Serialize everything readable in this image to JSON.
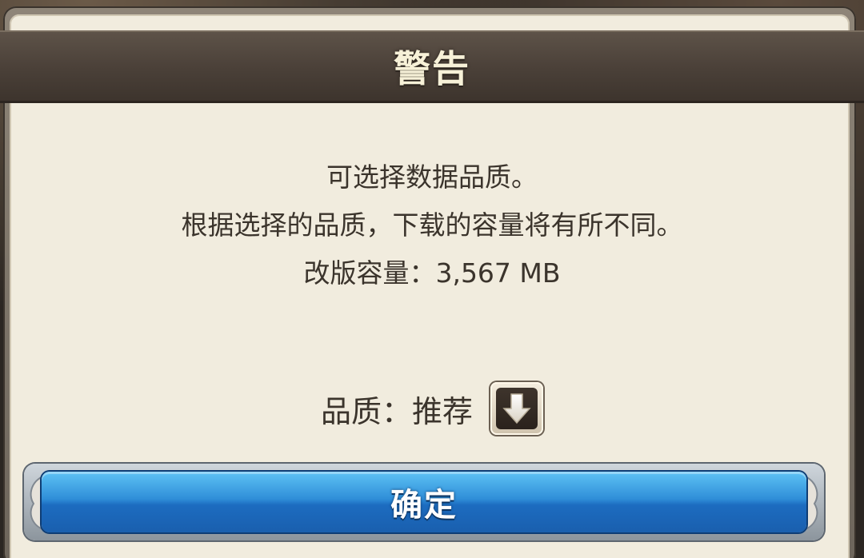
{
  "dialog": {
    "title": "警告",
    "message_lines": [
      "可选择数据品质。",
      "根据选择的品质，下载的容量将有所不同。",
      "改版容量：3,567 MB"
    ],
    "quality": {
      "label": "品质：推荐",
      "dropdown_icon": "down-arrow-icon"
    },
    "confirm_label": "确定"
  },
  "colors": {
    "title_bar": "#4a4038",
    "panel_bg": "#f1ecde",
    "text": "#3b342c",
    "confirm_button": "#2f8ed8"
  }
}
